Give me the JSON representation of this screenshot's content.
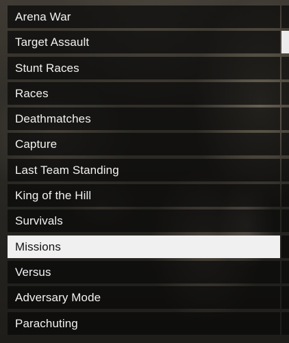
{
  "menu": {
    "items": [
      {
        "label": "Arena War",
        "selected": false
      },
      {
        "label": "Target Assault",
        "selected": false
      },
      {
        "label": "Stunt Races",
        "selected": false
      },
      {
        "label": "Races",
        "selected": false
      },
      {
        "label": "Deathmatches",
        "selected": false
      },
      {
        "label": "Capture",
        "selected": false
      },
      {
        "label": "Last Team Standing",
        "selected": false
      },
      {
        "label": "King of the Hill",
        "selected": false
      },
      {
        "label": "Survivals",
        "selected": false
      },
      {
        "label": "Missions",
        "selected": true
      },
      {
        "label": "Versus",
        "selected": false
      },
      {
        "label": "Adversary Mode",
        "selected": false
      },
      {
        "label": "Parachuting",
        "selected": false
      }
    ]
  },
  "colors": {
    "item_bg": "#080808",
    "item_text": "#f2f2f2",
    "selected_bg": "#f0f0f0",
    "selected_text": "#141414"
  }
}
